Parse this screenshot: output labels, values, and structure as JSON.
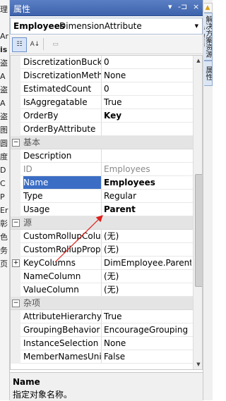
{
  "left_strip": {
    "chars": [
      "理",
      "",
      "Ar",
      "is",
      "盗",
      "A",
      "盗",
      "A",
      "盗",
      "图",
      "圆",
      "度",
      "D",
      "C",
      "P",
      "Er",
      "彰",
      "色",
      "务",
      "页"
    ],
    "bold_index": 3
  },
  "right_strip": {
    "tabs": [
      "解决方案资源管理器",
      "属性"
    ],
    "icon_glyph": "▲"
  },
  "panel": {
    "title": "属性",
    "btn_dropdown": "▾",
    "btn_pin": "-⊐",
    "btn_close": "×"
  },
  "object_selector": {
    "name": "Employees",
    "type": "DimensionAttribute",
    "arrow": "▼"
  },
  "toolbar": {
    "categorized_label": "☷",
    "alpha_label": "A↓",
    "pages_label": "▭"
  },
  "grid": {
    "rows": [
      {
        "kind": "prop",
        "name": "DiscretizationBucket",
        "value": "0"
      },
      {
        "kind": "prop",
        "name": "DiscretizationMethod",
        "value": "None"
      },
      {
        "kind": "prop",
        "name": "EstimatedCount",
        "value": "0"
      },
      {
        "kind": "prop",
        "name": "IsAggregatable",
        "value": "True"
      },
      {
        "kind": "prop",
        "name": "OrderBy",
        "value": "Key",
        "bold": true
      },
      {
        "kind": "prop",
        "name": "OrderByAttribute",
        "value": ""
      },
      {
        "kind": "cat",
        "label": "基本",
        "toggle": "−"
      },
      {
        "kind": "prop",
        "name": "Description",
        "value": ""
      },
      {
        "kind": "prop",
        "name": "ID",
        "value": "Employees",
        "gray": true
      },
      {
        "kind": "prop",
        "name": "Name",
        "value": "Employees",
        "bold": true,
        "selected": true
      },
      {
        "kind": "prop",
        "name": "Type",
        "value": "Regular"
      },
      {
        "kind": "prop",
        "name": "Usage",
        "value": "Parent",
        "bold": true
      },
      {
        "kind": "cat",
        "label": "源",
        "toggle": "−"
      },
      {
        "kind": "prop",
        "name": "CustomRollupColumn",
        "value": "(无)"
      },
      {
        "kind": "prop",
        "name": "CustomRollupPropertiesColumn",
        "value": "(无)"
      },
      {
        "kind": "prop",
        "name": "KeyColumns",
        "value": "DimEmployee.ParentEmployeeKey",
        "expand": "+"
      },
      {
        "kind": "prop",
        "name": "NameColumn",
        "value": "(无)"
      },
      {
        "kind": "prop",
        "name": "ValueColumn",
        "value": "(无)"
      },
      {
        "kind": "cat",
        "label": "杂项",
        "toggle": "−"
      },
      {
        "kind": "prop",
        "name": "AttributeHierarchyOrdered",
        "value": "True"
      },
      {
        "kind": "prop",
        "name": "GroupingBehavior",
        "value": "EncourageGrouping"
      },
      {
        "kind": "prop",
        "name": "InstanceSelection",
        "value": "None"
      },
      {
        "kind": "prop",
        "name": "MemberNamesUnique",
        "value": "False"
      }
    ]
  },
  "scrollbar": {
    "up": "▲",
    "down": "▼"
  },
  "description": {
    "title": "Name",
    "text": "指定对象名称。"
  },
  "colors": {
    "title_bar": "#4a70b8",
    "selection": "#3b6dc4",
    "annotation_arrow": "#e0201a"
  }
}
